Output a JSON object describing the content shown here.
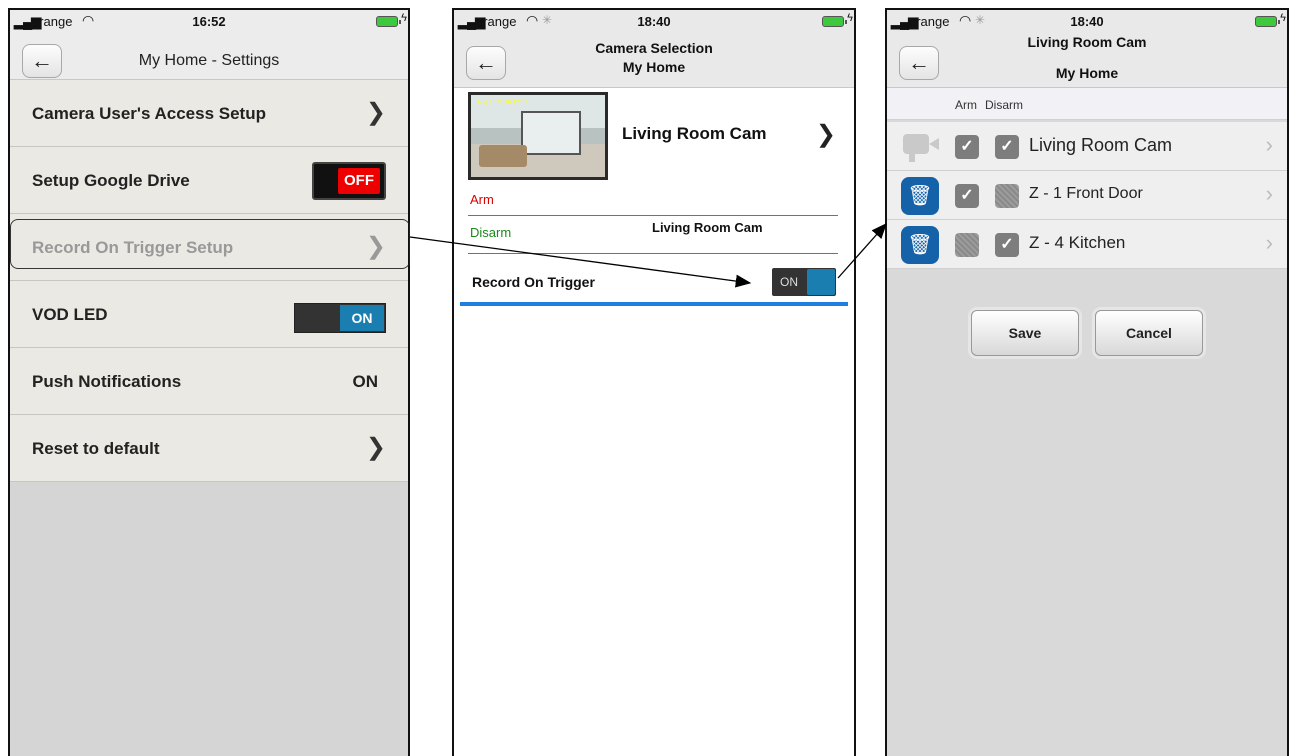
{
  "panel1": {
    "status": {
      "carrier": "orange",
      "time": "16:52"
    },
    "nav_title": "My Home - Settings",
    "rows": [
      {
        "label": "Camera User's Access Setup"
      },
      {
        "label": "Setup Google Drive",
        "toggle": "OFF"
      },
      {
        "label": "Record On Trigger Setup"
      },
      {
        "label": "VOD LED",
        "toggle": "ON"
      },
      {
        "label": "Push Notifications",
        "value": "ON"
      },
      {
        "label": "Reset to default"
      }
    ]
  },
  "panel2": {
    "status": {
      "carrier": "orange",
      "time": "18:40"
    },
    "nav_title": "Camera Selection",
    "nav_subtitle": "My Home",
    "camera_name": "Living Room Cam",
    "thumb_stamp": "Aug 15 2016 12:37",
    "arm_label": "Arm",
    "disarm_label": "Disarm",
    "disarm_camera": "Living Room Cam",
    "record_label": "Record On Trigger",
    "record_toggle": "ON"
  },
  "panel3": {
    "status": {
      "carrier": "orange",
      "time": "18:40"
    },
    "nav_title": "Living Room Cam",
    "nav_subtitle": "My Home",
    "arm_label": "Arm",
    "disarm_label": "Disarm",
    "zones": [
      {
        "name": "Living Room Cam",
        "arm": true,
        "disarm": true
      },
      {
        "name": "Z - 1 Front Door",
        "arm": true,
        "disarm": false
      },
      {
        "name": "Z - 4 Kitchen",
        "arm": false,
        "disarm": true
      }
    ],
    "save_label": "Save",
    "cancel_label": "Cancel"
  },
  "colors": {
    "on_blue": "#1a7fb0",
    "off_red": "#e00000",
    "trash_blue": "#1662a8",
    "arm_red": "#d00000",
    "disarm_green": "#1a8a1a"
  }
}
